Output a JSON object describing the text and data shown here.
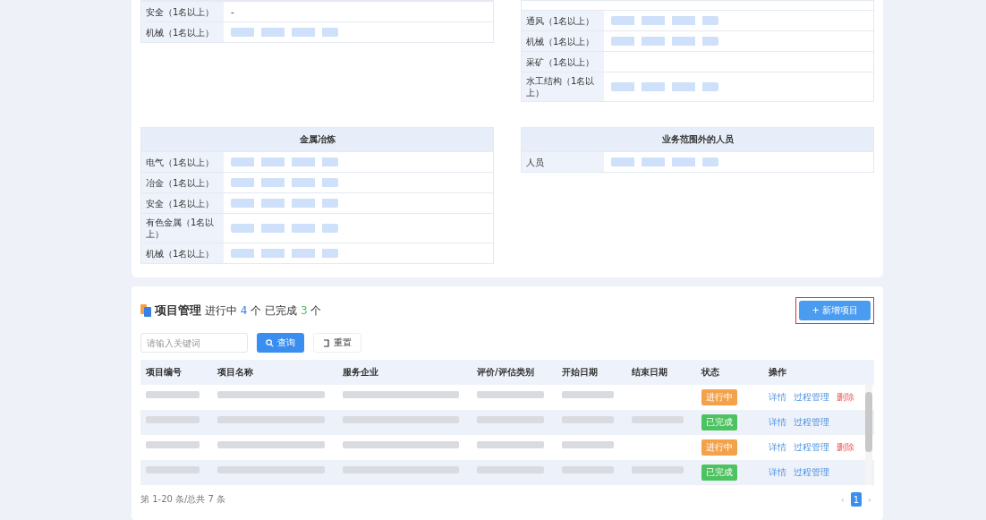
{
  "qualification_tables": [
    {
      "rows": [
        {
          "label": "安全（1名以上）",
          "value": "-"
        },
        {
          "label": "机械（1名以上）",
          "blurred": true
        }
      ]
    },
    {
      "rows": [
        {
          "label": "通风（1名以上）",
          "blurred": true
        },
        {
          "label": "机械（1名以上）",
          "blurred": true
        },
        {
          "label": "采矿（1名以上）",
          "blurred": false
        },
        {
          "label": "水工结构（1名以上）",
          "blurred": true
        }
      ]
    },
    {
      "title": "金属冶炼",
      "rows": [
        {
          "label": "电气（1名以上）",
          "blurred": true
        },
        {
          "label": "冶金（1名以上）",
          "blurred": true
        },
        {
          "label": "安全（1名以上）",
          "blurred": true
        },
        {
          "label": "有色金属（1名以上）",
          "blurred": true
        },
        {
          "label": "机械（1名以上）",
          "blurred": true
        }
      ]
    },
    {
      "title": "业务范围外的人员",
      "rows": [
        {
          "label": "人员",
          "blurred": true
        }
      ]
    }
  ],
  "projects": {
    "title": "项目管理",
    "ongoing_label": "进行中",
    "ongoing_count": "4",
    "unit_1": "个",
    "done_label": "已完成",
    "done_count": "3",
    "unit_2": "个",
    "add_button": {
      "label": "+ 新增项目",
      "highlighted": true
    },
    "search": {
      "placeholder": "请输入关键词"
    },
    "search_button": "查询",
    "reset_button": "重置",
    "columns": [
      "项目编号",
      "项目名称",
      "服务企业",
      "评价/评估类别",
      "开始日期",
      "结束日期",
      "状态",
      "操作"
    ],
    "rows": [
      {
        "blurred_cells": [
          true,
          true,
          true,
          true,
          true,
          false
        ],
        "status": {
          "label": "进行中",
          "kind": "ongoing"
        },
        "actions": [
          {
            "label": "详情",
            "kind": "link"
          },
          {
            "label": "过程管理",
            "kind": "link"
          },
          {
            "label": "删除",
            "kind": "danger"
          }
        ]
      },
      {
        "blurred_cells": [
          true,
          true,
          true,
          true,
          true,
          true
        ],
        "status": {
          "label": "已完成",
          "kind": "done"
        },
        "actions": [
          {
            "label": "详情",
            "kind": "link"
          },
          {
            "label": "过程管理",
            "kind": "link"
          }
        ]
      },
      {
        "blurred_cells": [
          true,
          true,
          true,
          true,
          true,
          false
        ],
        "status": {
          "label": "进行中",
          "kind": "ongoing"
        },
        "actions": [
          {
            "label": "详情",
            "kind": "link"
          },
          {
            "label": "过程管理",
            "kind": "link"
          },
          {
            "label": "删除",
            "kind": "danger"
          }
        ]
      },
      {
        "blurred_cells": [
          true,
          true,
          true,
          true,
          true,
          true
        ],
        "status": {
          "label": "已完成",
          "kind": "done"
        },
        "actions": [
          {
            "label": "详情",
            "kind": "link"
          },
          {
            "label": "过程管理",
            "kind": "link"
          }
        ]
      }
    ],
    "pagination": {
      "summary": "第 1-20 条/总共 7 条",
      "prev": "‹",
      "pages": [
        {
          "label": "1",
          "selected": true
        }
      ],
      "next": "›"
    }
  }
}
